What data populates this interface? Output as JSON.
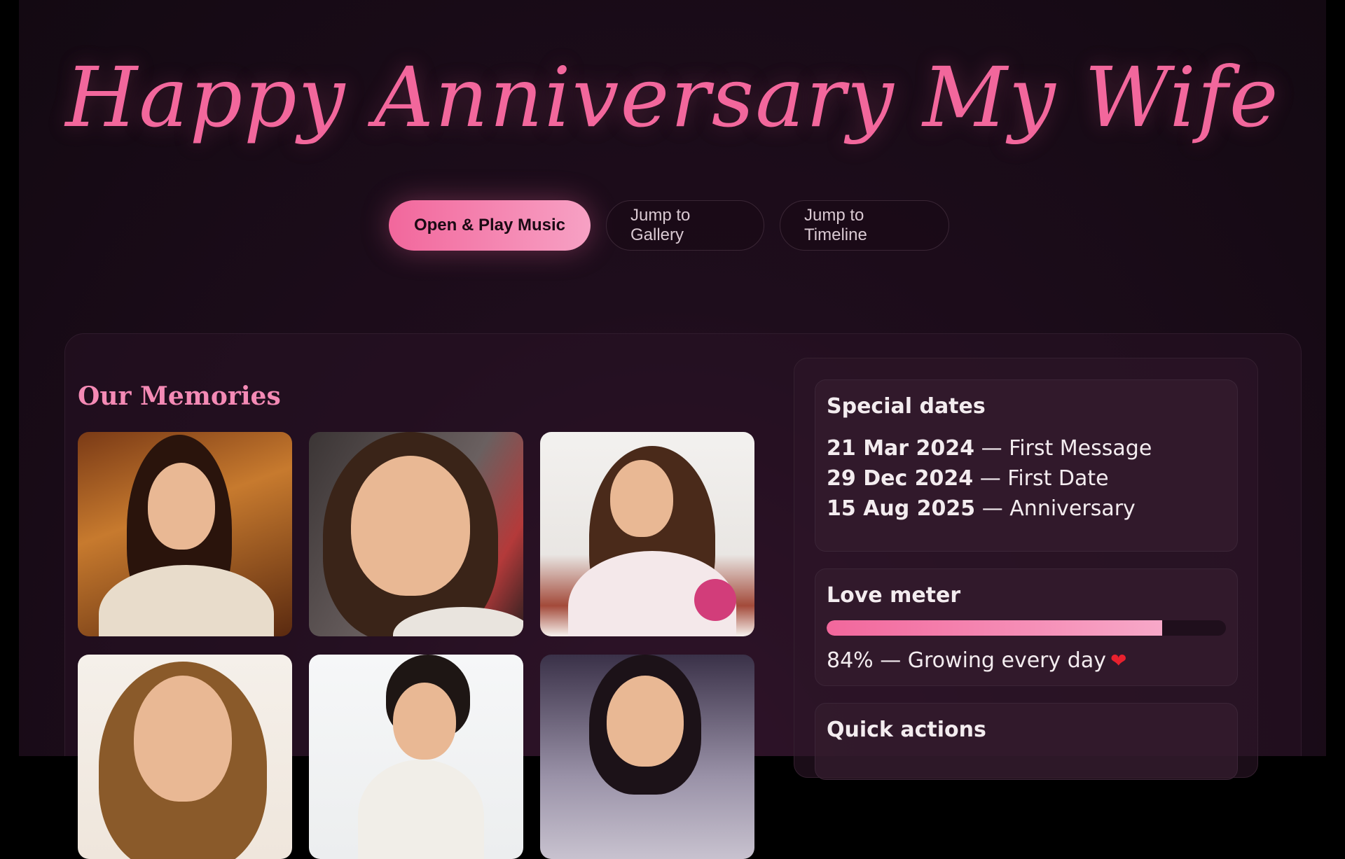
{
  "hero": {
    "title": "Happy Anniversary My Wife",
    "buttons": {
      "play_music": "Open & Play Music",
      "gallery": "Jump to Gallery",
      "timeline": "Jump to Timeline"
    }
  },
  "memories": {
    "title": "Our Memories",
    "photos": [
      {
        "alt": "portrait-1"
      },
      {
        "alt": "portrait-2"
      },
      {
        "alt": "portrait-3"
      },
      {
        "alt": "portrait-4"
      },
      {
        "alt": "portrait-5"
      },
      {
        "alt": "portrait-6"
      }
    ]
  },
  "special_dates": {
    "title": "Special dates",
    "items": [
      {
        "date": "21 Mar 2024",
        "label": "First Message"
      },
      {
        "date": "29 Dec 2024",
        "label": "First Date"
      },
      {
        "date": "15 Aug 2025",
        "label": "Anniversary"
      }
    ],
    "separator": "—"
  },
  "love_meter": {
    "title": "Love meter",
    "value_percent": 84,
    "label": "84% — Growing every day",
    "icon": "heart-icon"
  },
  "quick_actions": {
    "title": "Quick actions"
  },
  "colors": {
    "accent": "#f2679c",
    "accent_light": "#f7a1c4",
    "background": "#1e0d1c"
  }
}
